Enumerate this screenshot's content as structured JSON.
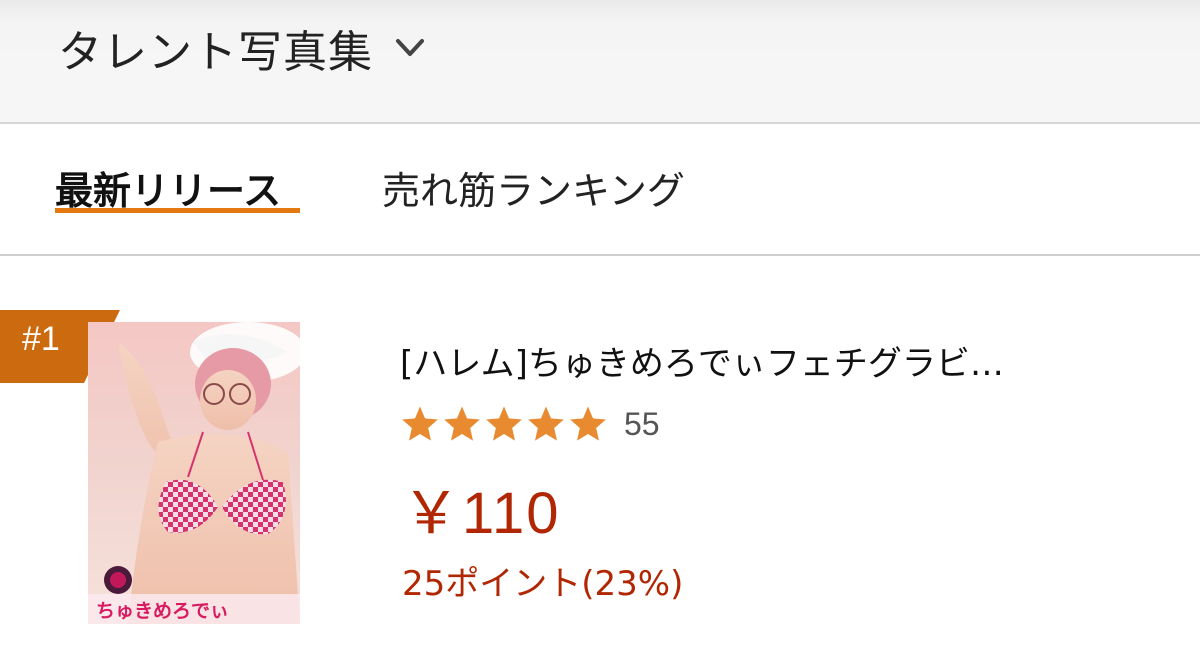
{
  "header": {
    "category_label": "タレント写真集",
    "dropdown_icon": "chevron-down-icon"
  },
  "tabs": [
    {
      "label": "最新リリース",
      "active": true
    },
    {
      "label": "売れ筋ランキング",
      "active": false
    }
  ],
  "accent_color": "#e47911",
  "price_color": "#b12704",
  "products": [
    {
      "rank": "#1",
      "cover_text": "ちゅきめろでぃ",
      "title": "[ハレム]ちゅきめろでぃフェチグラビ…",
      "rating": 5,
      "review_count": "55",
      "price": "￥110",
      "points": "25ポイント(23%)"
    }
  ]
}
